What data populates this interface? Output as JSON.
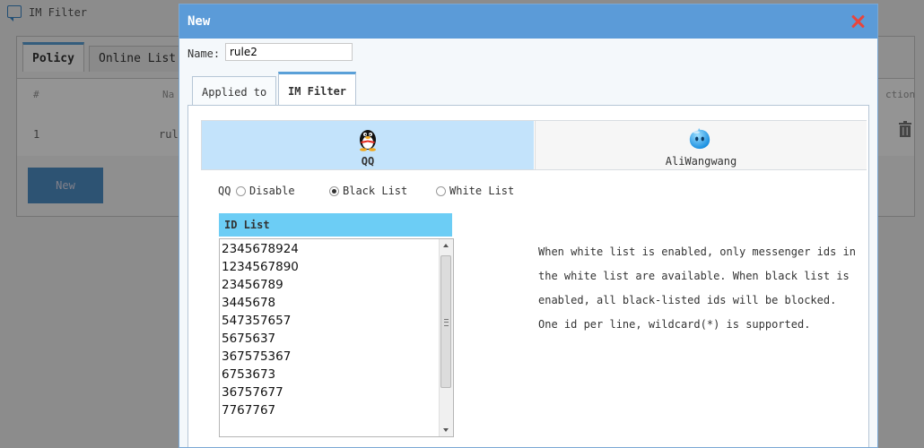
{
  "background": {
    "window_title": "IM Filter",
    "tabs": [
      "Policy",
      "Online List"
    ],
    "table_headers": [
      "#",
      "Na",
      "ction"
    ],
    "row": [
      "1",
      "rul"
    ],
    "new_button": "New"
  },
  "dialog": {
    "title": "New",
    "name_label": "Name:",
    "name_value": "rule2",
    "tabs": [
      {
        "label": "Applied to",
        "active": false
      },
      {
        "label": "IM Filter",
        "active": true
      }
    ],
    "messengers": [
      {
        "label": "QQ",
        "icon": "qq-penguin-icon",
        "selected": true
      },
      {
        "label": "AliWangwang",
        "icon": "aliwangwang-icon",
        "selected": false
      }
    ],
    "radio_group_label": "QQ",
    "radios": [
      {
        "label": "Disable",
        "checked": false
      },
      {
        "label": "Black List",
        "checked": true
      },
      {
        "label": "White List",
        "checked": false
      }
    ],
    "id_list": {
      "header": "ID List",
      "lines": [
        "2345678924",
        "1234567890",
        "23456789",
        "3445678",
        "547357657",
        "5675637",
        "367575367",
        "6753673",
        "36757677",
        "7767767"
      ]
    },
    "help_text": "When white list is enabled, only messenger ids in the white list are available. When black list is enabled, all black-listed ids will be blocked. One id per line, wildcard(*) is supported."
  },
  "colors": {
    "dialog_header": "#5b9bd8",
    "qq_selected_bg": "#c3e3fb",
    "id_list_header": "#6ccdf5",
    "close_x": "#e8453c"
  }
}
